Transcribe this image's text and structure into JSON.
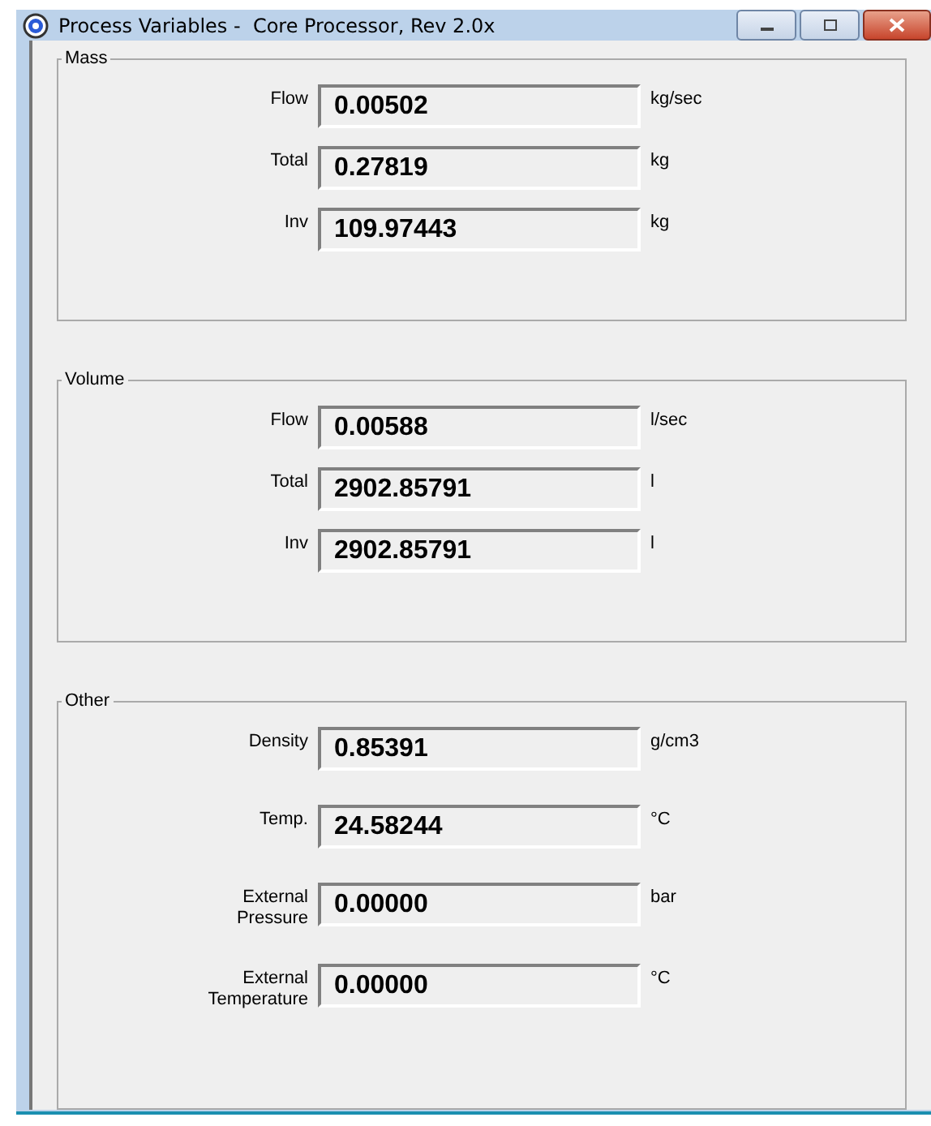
{
  "window": {
    "title": "Process Variables -  Core Processor, Rev 2.0x"
  },
  "groups": [
    {
      "title": "Mass",
      "rows": [
        {
          "label": "Flow",
          "value": "0.00502",
          "unit": "kg/sec"
        },
        {
          "label": "Total",
          "value": "0.27819",
          "unit": "kg"
        },
        {
          "label": "Inv",
          "value": "109.97443",
          "unit": "kg"
        }
      ]
    },
    {
      "title": "Volume",
      "rows": [
        {
          "label": "Flow",
          "value": "0.00588",
          "unit": "l/sec"
        },
        {
          "label": "Total",
          "value": "2902.85791",
          "unit": "l"
        },
        {
          "label": "Inv",
          "value": "2902.85791",
          "unit": "l"
        }
      ]
    },
    {
      "title": "Other",
      "rows": [
        {
          "label": "Density",
          "value": "0.85391",
          "unit": "g/cm3"
        },
        {
          "label": "Temp.",
          "value": "24.58244",
          "unit": "°C"
        },
        {
          "label": "External\nPressure",
          "value": "0.00000",
          "unit": "bar"
        },
        {
          "label": "External\nTemperature",
          "value": "0.00000",
          "unit": "°C"
        }
      ]
    }
  ]
}
